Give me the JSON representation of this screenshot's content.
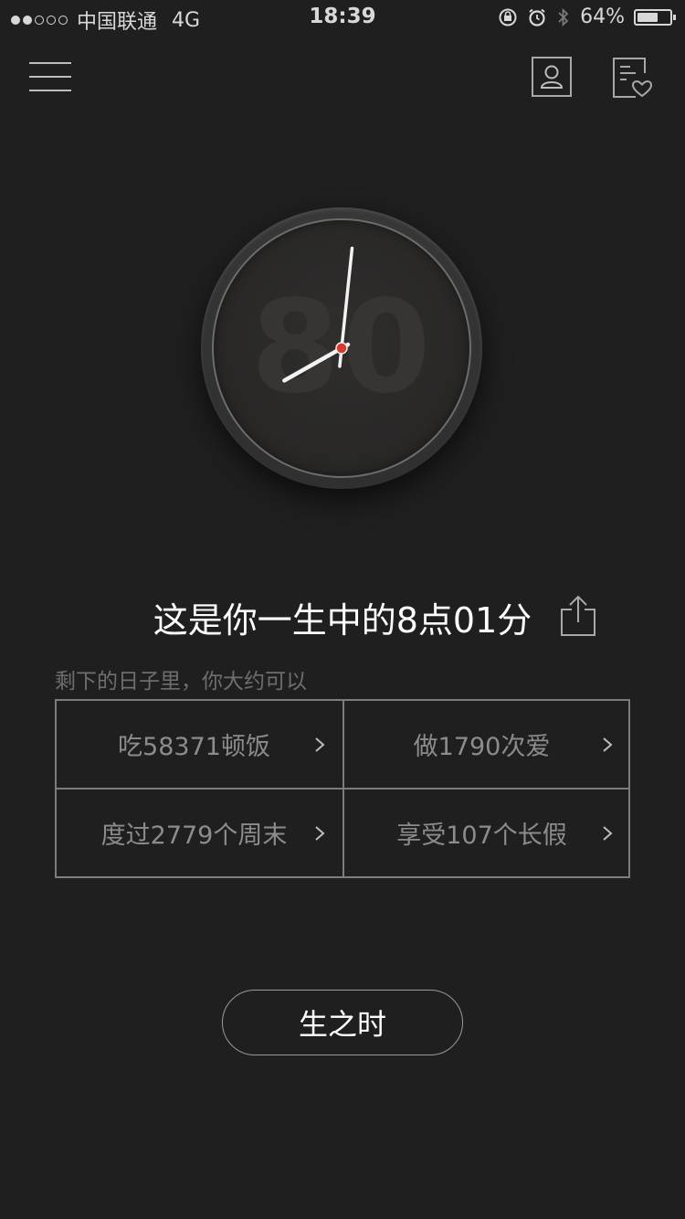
{
  "status_bar": {
    "carrier": "中国联通",
    "network": "4G",
    "time": "18:39",
    "battery": "64%",
    "battery_level": 0.64,
    "signal_bars_filled": 2,
    "signal_bars_total": 5
  },
  "nav": {
    "menu_icon": "hamburger-menu-icon",
    "profile_icon": "user-profile-icon",
    "favorites_icon": "favorites-list-icon"
  },
  "clock": {
    "age_number": "80",
    "hour": 8,
    "minute": 1,
    "face_color": "#282726",
    "hand_color": "#f2f2f2",
    "center_color": "#d83a2e"
  },
  "headline": {
    "text": "这是你一生中的8点01分",
    "share_icon": "share-icon"
  },
  "subtitle": "剩下的日子里，你大约可以",
  "stats": [
    {
      "label": "吃58371顿饭"
    },
    {
      "label": "做1790次爱"
    },
    {
      "label": "度过2779个周末"
    },
    {
      "label": "享受107个长假"
    }
  ],
  "bottom_button": {
    "label": "生之时"
  },
  "colors": {
    "background": "#1f1f1f",
    "border": "#7d7d7d",
    "muted_text": "#8c8c8c",
    "subtitle_text": "#6e6e6e"
  }
}
